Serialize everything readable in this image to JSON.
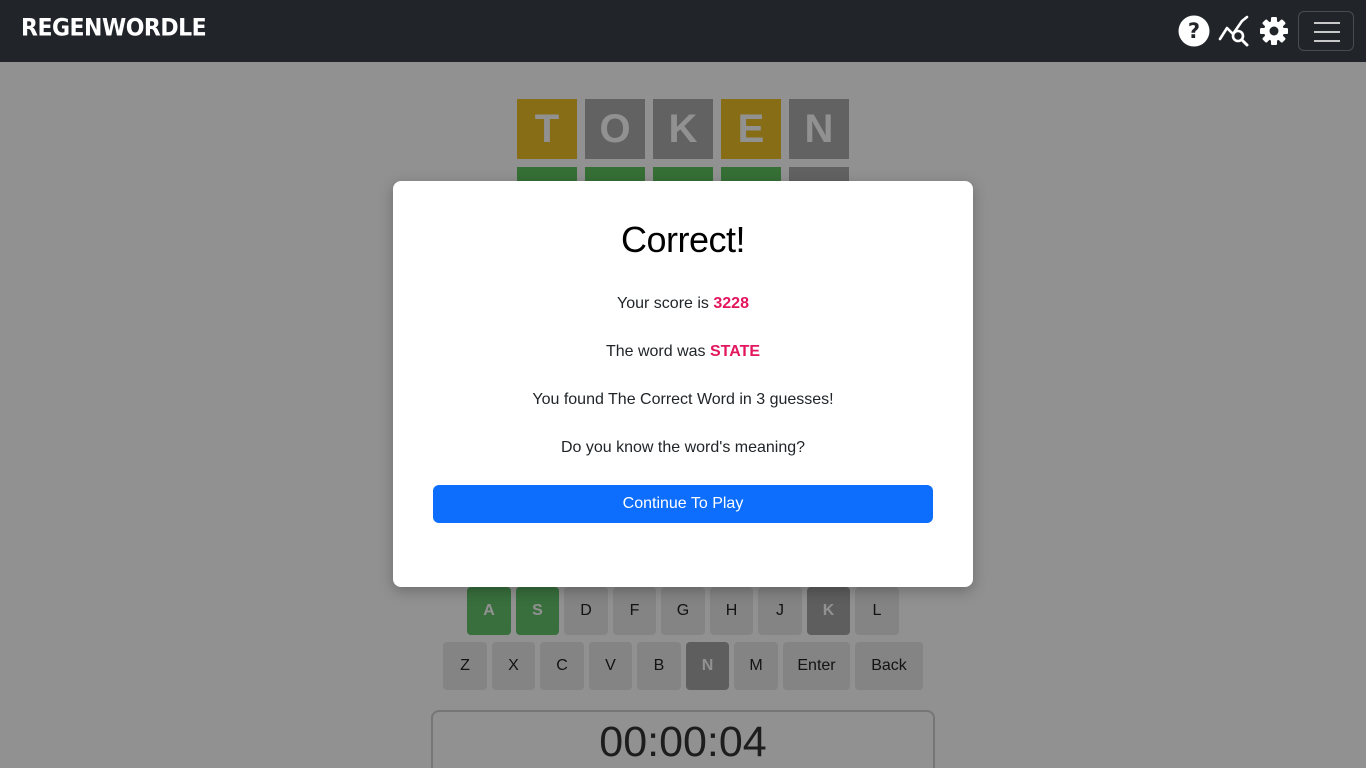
{
  "navbar": {
    "brand": "REGENWORDLE",
    "icons": [
      "help-icon",
      "stats-search-icon",
      "gear-icon",
      "hamburger-menu-icon"
    ]
  },
  "board": {
    "row1": [
      {
        "letter": "T",
        "state": "present"
      },
      {
        "letter": "O",
        "state": "absent"
      },
      {
        "letter": "K",
        "state": "absent"
      },
      {
        "letter": "E",
        "state": "present"
      },
      {
        "letter": "N",
        "state": "absent"
      }
    ],
    "row2_states": [
      "correct",
      "correct",
      "correct",
      "correct",
      "absent"
    ]
  },
  "keyboard": {
    "row2": [
      {
        "label": "A",
        "state": "correct"
      },
      {
        "label": "S",
        "state": "correct"
      },
      {
        "label": "D",
        "state": "unused"
      },
      {
        "label": "F",
        "state": "unused"
      },
      {
        "label": "G",
        "state": "unused"
      },
      {
        "label": "H",
        "state": "unused"
      },
      {
        "label": "J",
        "state": "unused"
      },
      {
        "label": "K",
        "state": "absent"
      },
      {
        "label": "L",
        "state": "unused"
      }
    ],
    "row3": [
      {
        "label": "Z",
        "state": "unused"
      },
      {
        "label": "X",
        "state": "unused"
      },
      {
        "label": "C",
        "state": "unused"
      },
      {
        "label": "V",
        "state": "unused"
      },
      {
        "label": "B",
        "state": "unused"
      },
      {
        "label": "N",
        "state": "absent"
      },
      {
        "label": "M",
        "state": "unused"
      },
      {
        "label": "Enter",
        "state": "unused"
      },
      {
        "label": "Back",
        "state": "unused"
      }
    ]
  },
  "timer": "00:00:04",
  "modal": {
    "title": "Correct!",
    "score_prefix": "Your score is",
    "score": "3228",
    "word_prefix": "The word was",
    "word": "STATE",
    "found_text": "You found The Correct Word in 3 guesses!",
    "meaning_text": "Do you know the word's meaning?",
    "button": "Continue To Play"
  },
  "colors": {
    "navbar": "#212529",
    "present": "#f0c02a",
    "absent": "#adadad",
    "correct": "#5fc35f",
    "highlight": "#e3155d",
    "primary_button": "#0d6efd"
  }
}
